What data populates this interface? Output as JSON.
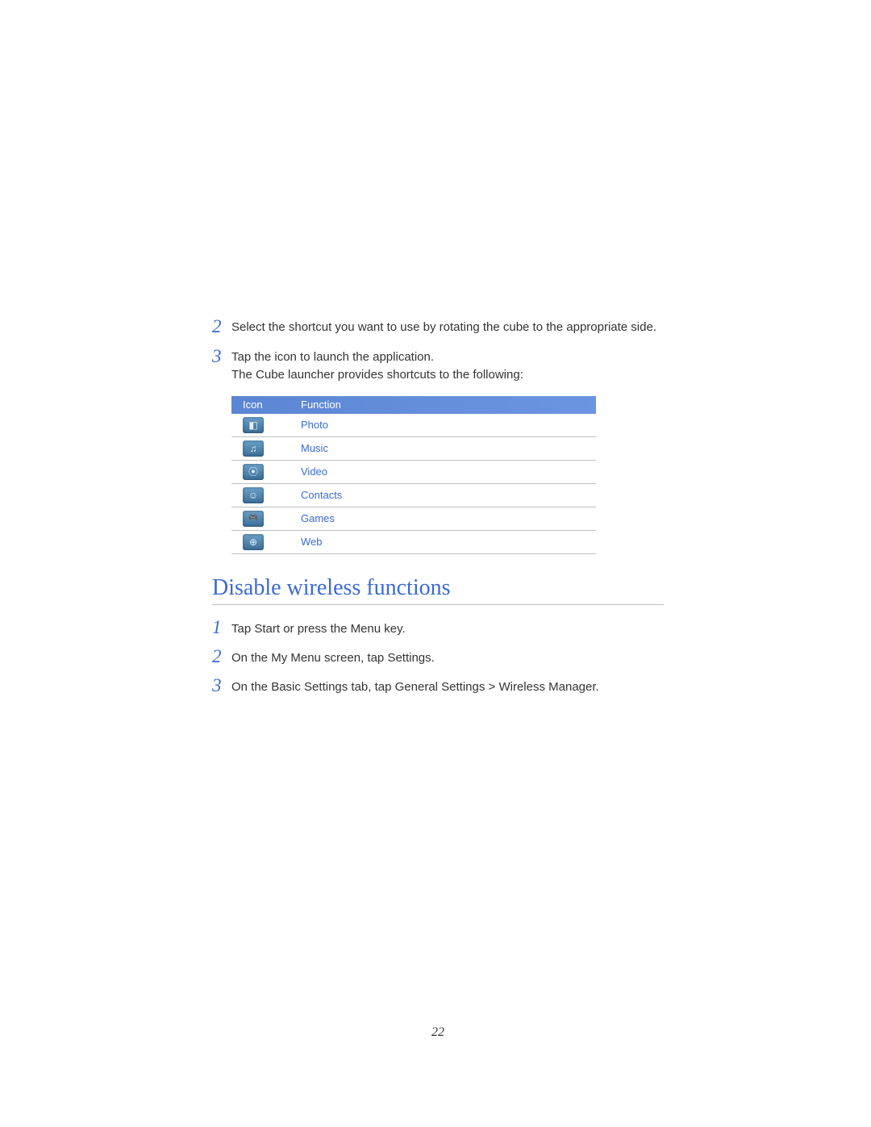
{
  "upper_steps": [
    {
      "num": "2",
      "text": "Select the shortcut you want to use by rotating the cube to the appropriate side."
    },
    {
      "num": "3",
      "text_line1": "Tap the icon to launch the application.",
      "text_line2": "The Cube launcher provides shortcuts to the following:"
    }
  ],
  "table": {
    "header_icon": "Icon",
    "header_function": "Function",
    "rows": [
      {
        "icon": "photo-icon",
        "glyph": "◧",
        "function": "Photo"
      },
      {
        "icon": "music-icon",
        "glyph": "♫",
        "function": "Music"
      },
      {
        "icon": "video-icon",
        "glyph": "⦿",
        "function": "Video"
      },
      {
        "icon": "contacts-icon",
        "glyph": "☺",
        "function": "Contacts"
      },
      {
        "icon": "games-icon",
        "glyph": "🎮",
        "function": "Games"
      },
      {
        "icon": "web-icon",
        "glyph": "⊕",
        "function": "Web"
      }
    ]
  },
  "section_heading": "Disable wireless functions",
  "lower_steps": [
    {
      "num": "1",
      "parts": [
        "Tap ",
        "Start",
        " or press the Menu key."
      ]
    },
    {
      "num": "2",
      "parts": [
        "On the ",
        "My Menu",
        " screen, tap ",
        "Settings",
        "."
      ]
    },
    {
      "num": "3",
      "parts": [
        "On the ",
        "Basic Settings",
        " tab, tap ",
        "General Settings",
        " > ",
        "Wireless Manager",
        "."
      ]
    }
  ],
  "page_number": "22"
}
